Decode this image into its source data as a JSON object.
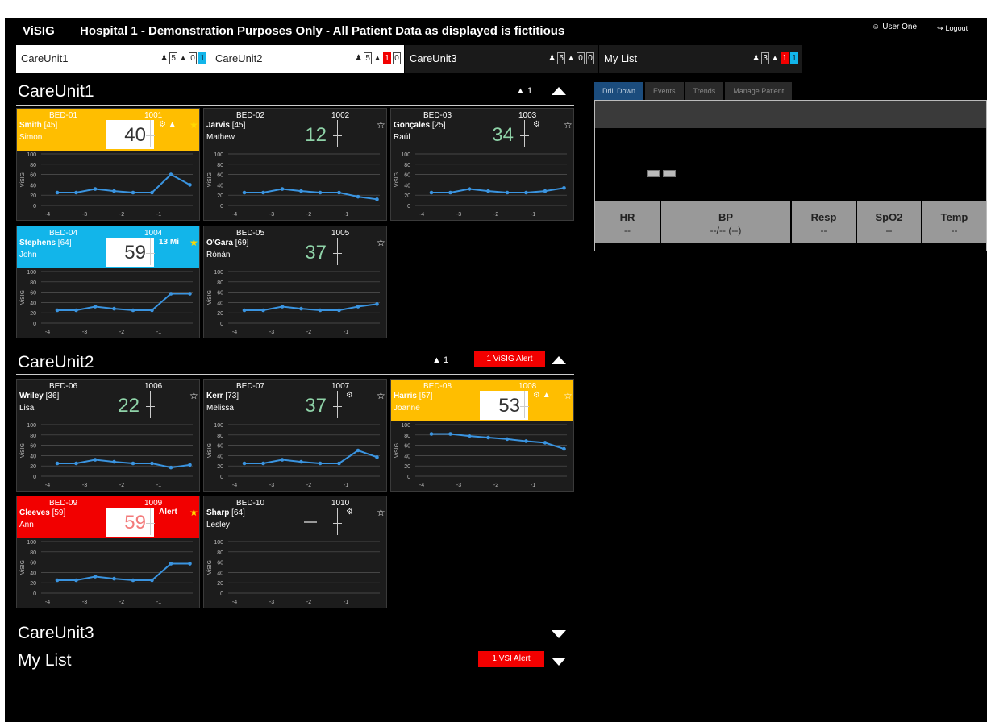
{
  "header": {
    "brand": "ViSIG",
    "title": "Hospital 1 - Demonstration Purposes Only - All Patient Data as displayed is fictitious",
    "user": "User One",
    "logout": "Logout"
  },
  "tabs": [
    {
      "name": "CareUnit1",
      "patients": "5",
      "alerts": "0",
      "third": "1"
    },
    {
      "name": "CareUnit2",
      "patients": "5",
      "alerts": "1",
      "third": "0"
    },
    {
      "name": "CareUnit3",
      "patients": "5",
      "alerts": "0",
      "third": "0"
    },
    {
      "name": "My List",
      "patients": "3",
      "alerts": "1",
      "third": "1"
    }
  ],
  "sections": {
    "cu1": {
      "title": "CareUnit1",
      "warn_count": "1"
    },
    "cu2": {
      "title": "CareUnit2",
      "warn_count": "1",
      "alert": "1 ViSIG Alert"
    },
    "cu3": {
      "title": "CareUnit3"
    },
    "mylist": {
      "title": "My List",
      "alert": "1 VSI Alert"
    }
  },
  "colors": {
    "yellow": "#ffbe00",
    "blue": "#12b5ea",
    "red": "#f20000",
    "green": "#8fd3a8",
    "line": "#3a94e0"
  },
  "chart_axis": {
    "y_ticks": [
      "100",
      "80",
      "60",
      "40",
      "20",
      "0"
    ],
    "x_ticks": [
      "-4",
      "-3",
      "-2",
      "-1"
    ],
    "ylabel": "ViSIG"
  },
  "beds": [
    {
      "bed": "BED-01",
      "num": "1001",
      "surname": "Smith",
      "age": "[45]",
      "first": "Simon",
      "score": "40",
      "icons": "⚙ ▲",
      "star": "★",
      "values": [
        25,
        25,
        32,
        28,
        25,
        25,
        60,
        40
      ]
    },
    {
      "bed": "BED-02",
      "num": "1002",
      "surname": "Jarvis",
      "age": "[45]",
      "first": "Mathew",
      "score": "12",
      "icons": "",
      "star": "☆",
      "values": [
        25,
        25,
        32,
        28,
        25,
        25,
        17,
        12
      ]
    },
    {
      "bed": "BED-03",
      "num": "1003",
      "surname": "Gonçales",
      "age": "[25]",
      "first": "Raúl",
      "score": "34",
      "icons": "⚙",
      "star": "☆",
      "values": [
        25,
        25,
        32,
        28,
        25,
        25,
        28,
        34
      ]
    },
    {
      "bed": "BED-04",
      "num": "1004",
      "surname": "Stephens",
      "age": "[64]",
      "first": "John",
      "score": "59",
      "icons": "13 Mi",
      "star": "★",
      "values": [
        25,
        25,
        32,
        28,
        25,
        25,
        57,
        57
      ]
    },
    {
      "bed": "BED-05",
      "num": "1005",
      "surname": "O'Gara",
      "age": "[69]",
      "first": "Rónán",
      "score": "37",
      "icons": "",
      "star": "☆",
      "values": [
        25,
        25,
        32,
        28,
        25,
        25,
        32,
        37
      ]
    },
    {
      "bed": "BED-06",
      "num": "1006",
      "surname": "Wriley",
      "age": "[36]",
      "first": "Lisa",
      "score": "22",
      "icons": "",
      "star": "☆",
      "values": [
        25,
        25,
        32,
        28,
        25,
        25,
        17,
        22
      ]
    },
    {
      "bed": "BED-07",
      "num": "1007",
      "surname": "Kerr",
      "age": "[73]",
      "first": "Melissa",
      "score": "37",
      "icons": "⚙",
      "star": "☆",
      "values": [
        25,
        25,
        32,
        28,
        25,
        25,
        50,
        37
      ]
    },
    {
      "bed": "BED-08",
      "num": "1008",
      "surname": "Harris",
      "age": "[57]",
      "first": "Joanne",
      "score": "53",
      "icons": "⚙ ▲",
      "star": "☆",
      "values": [
        82,
        82,
        78,
        75,
        72,
        68,
        65,
        53
      ]
    },
    {
      "bed": "BED-09",
      "num": "1009",
      "surname": "Cleeves",
      "age": "[59]",
      "first": "Ann",
      "score": "59",
      "icons": "Alert",
      "star": "★",
      "values": [
        25,
        25,
        32,
        28,
        25,
        25,
        57,
        57
      ]
    },
    {
      "bed": "BED-10",
      "num": "1010",
      "surname": "Sharp",
      "age": "[64]",
      "first": "Lesley",
      "score": "",
      "icons": "⚙",
      "star": "☆",
      "values": []
    }
  ],
  "panel": {
    "tabs": [
      "Drill Down",
      "Events",
      "Trends",
      "Manage Patient"
    ],
    "vitals": [
      {
        "label": "HR",
        "value": "--"
      },
      {
        "label": "BP",
        "value": "--/-- (--)"
      },
      {
        "label": "Resp",
        "value": "--"
      },
      {
        "label": "SpO2",
        "value": "--"
      },
      {
        "label": "Temp",
        "value": "--"
      }
    ]
  }
}
